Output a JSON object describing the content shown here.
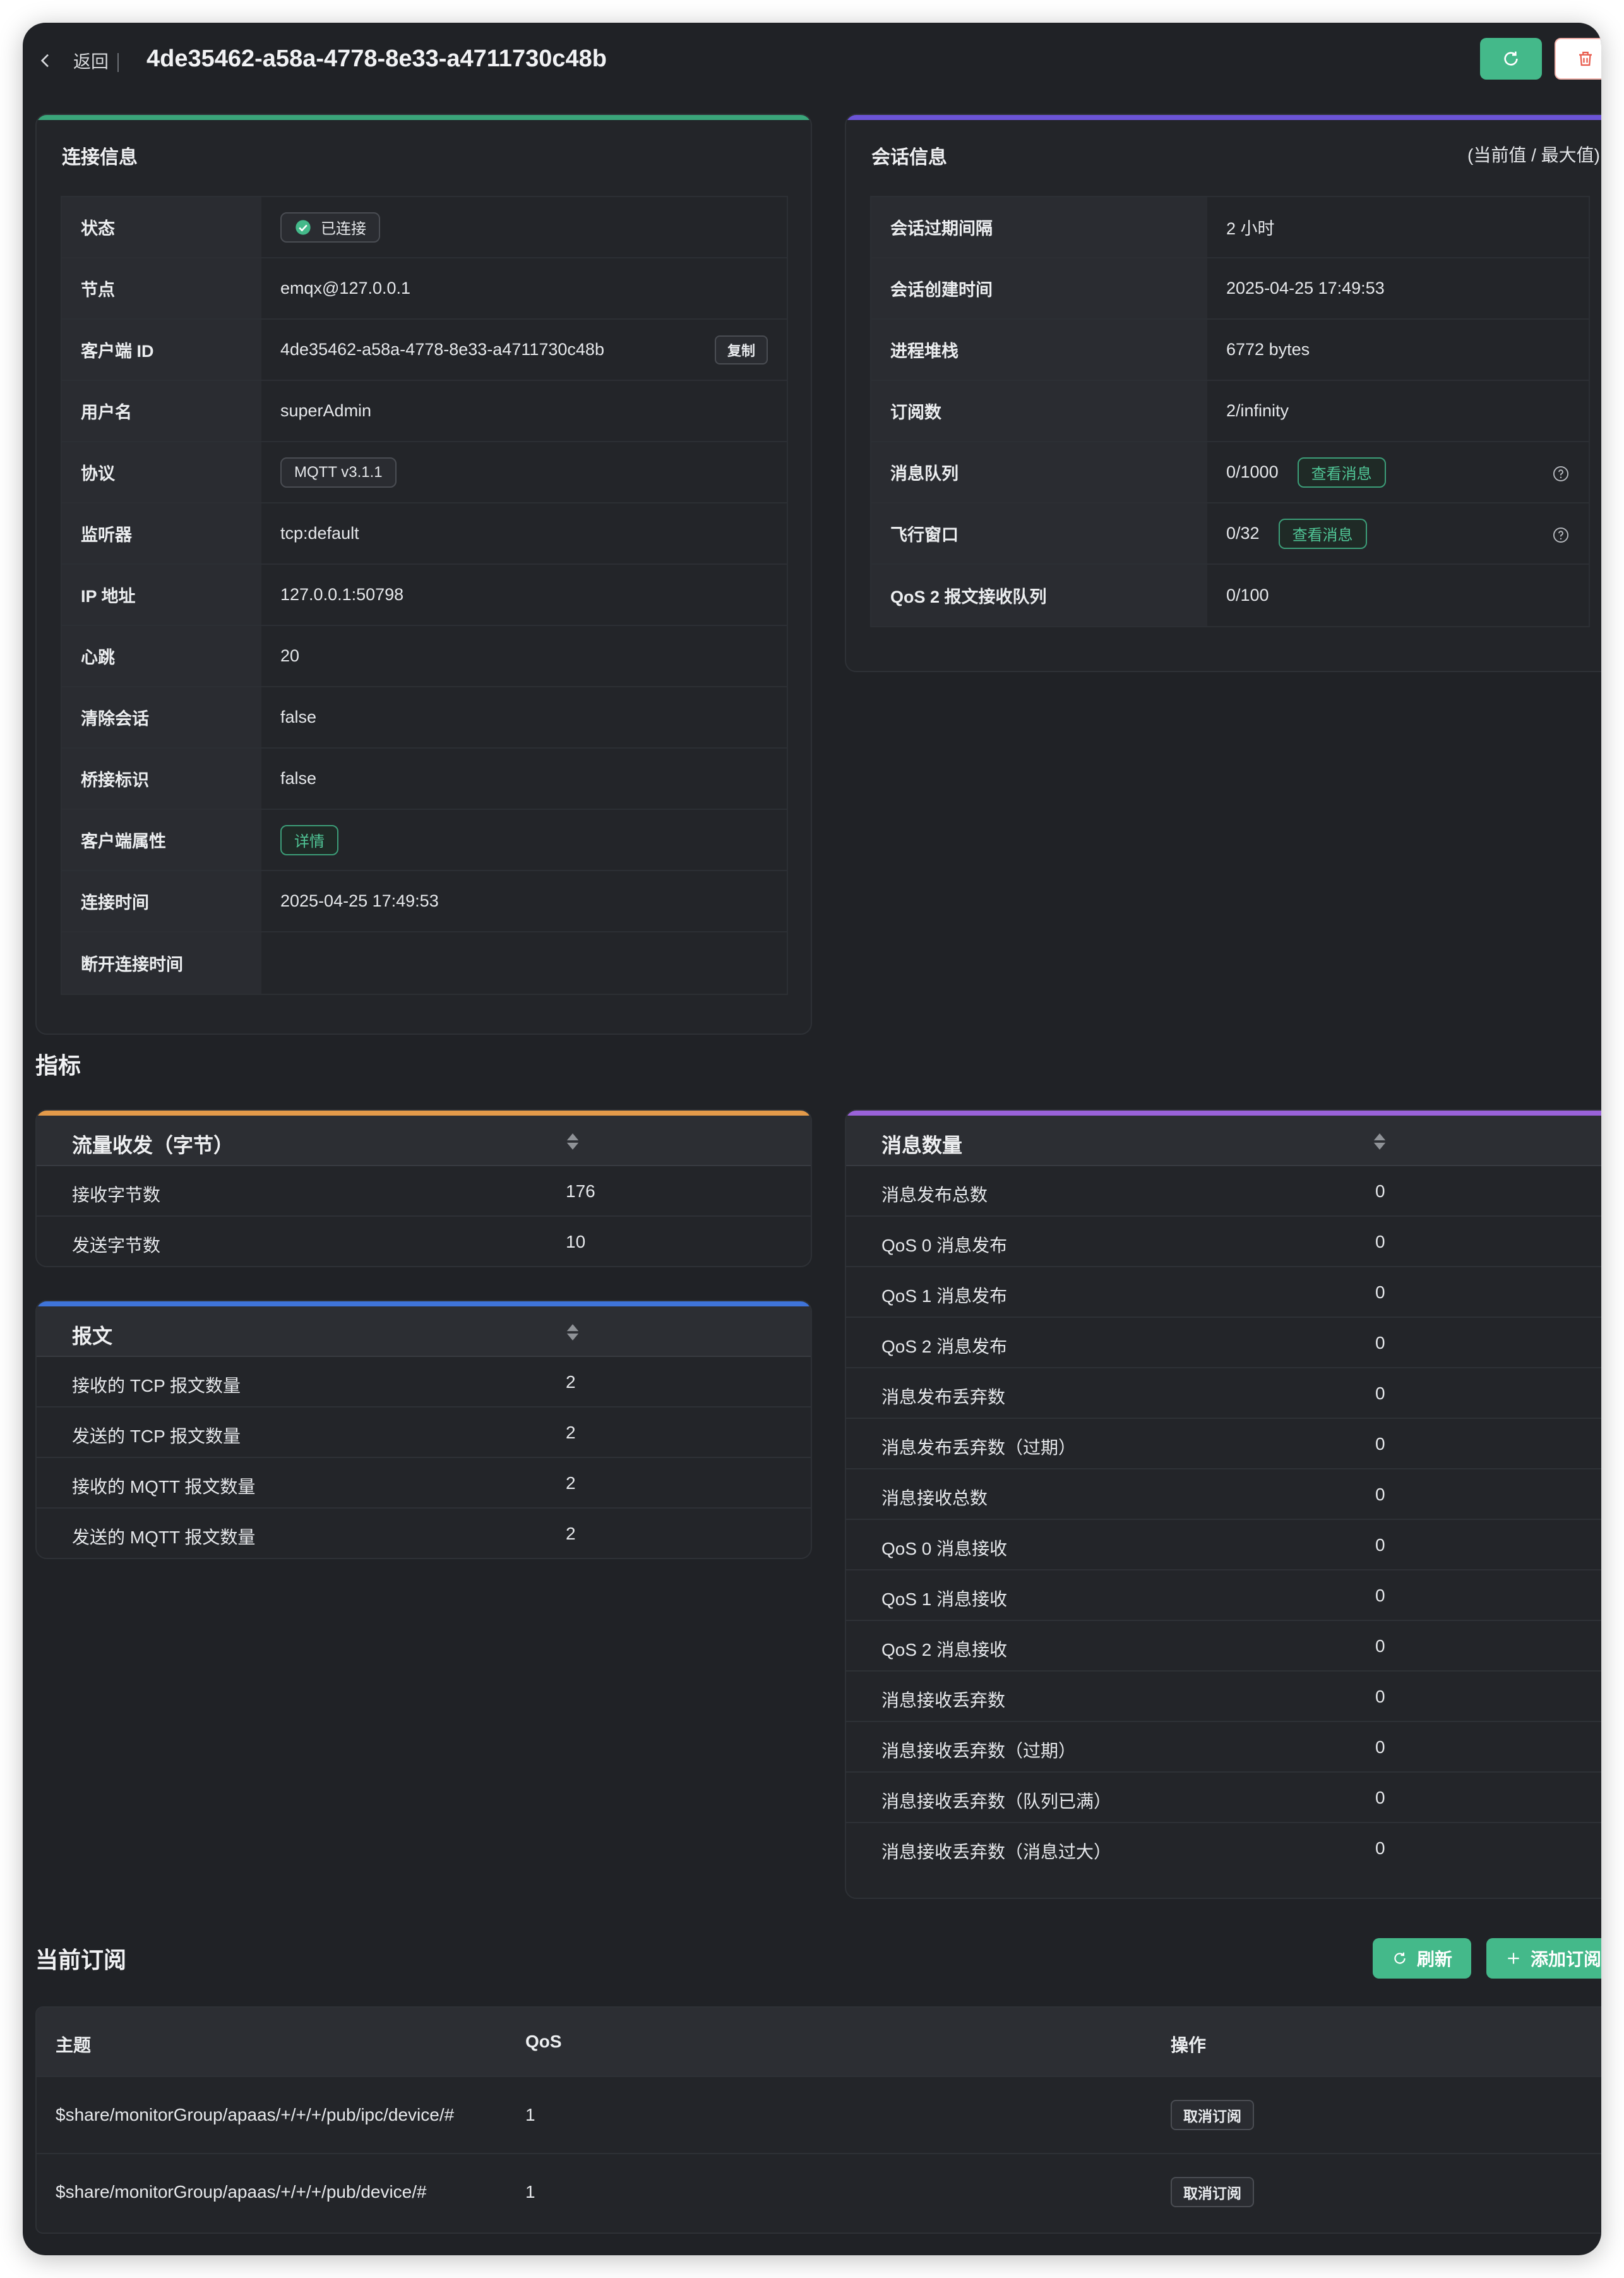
{
  "header": {
    "back_label": "返回",
    "title": "4de35462-a58a-4778-8e33-a4711730c48b"
  },
  "connection": {
    "title": "连接信息",
    "rows": [
      {
        "key": "状态",
        "value": "已连接"
      },
      {
        "key": "节点",
        "value": "emqx@127.0.0.1"
      },
      {
        "key": "客户端 ID",
        "value": "4de35462-a58a-4778-8e33-a4711730c48b"
      },
      {
        "key": "用户名",
        "value": "superAdmin"
      },
      {
        "key": "协议",
        "value": "MQTT v3.1.1"
      },
      {
        "key": "监听器",
        "value": "tcp:default"
      },
      {
        "key": "IP 地址",
        "value": "127.0.0.1:50798"
      },
      {
        "key": "心跳",
        "value": "20"
      },
      {
        "key": "清除会话",
        "value": "false"
      },
      {
        "key": "桥接标识",
        "value": "false"
      },
      {
        "key": "客户端属性",
        "value": "详情"
      },
      {
        "key": "连接时间",
        "value": "2025-04-25 17:49:53"
      },
      {
        "key": "断开连接时间",
        "value": ""
      }
    ],
    "copy_label": "复制"
  },
  "session": {
    "title": "会话信息",
    "note": "(当前值 / 最大值)",
    "view_messages_label": "查看消息",
    "rows": [
      {
        "key": "会话过期间隔",
        "value": "2 小时"
      },
      {
        "key": "会话创建时间",
        "value": "2025-04-25 17:49:53"
      },
      {
        "key": "进程堆栈",
        "value": "6772 bytes"
      },
      {
        "key": "订阅数",
        "value": "2/infinity"
      },
      {
        "key": "消息队列",
        "value": "0/1000"
      },
      {
        "key": "飞行窗口",
        "value": "0/32"
      },
      {
        "key": "QoS 2 报文接收队列",
        "value": "0/100"
      }
    ]
  },
  "metrics": {
    "title": "指标",
    "traffic": {
      "title": "流量收发（字节）",
      "rows": [
        {
          "name": "接收字节数",
          "value": "176"
        },
        {
          "name": "发送字节数",
          "value": "10"
        }
      ]
    },
    "packets": {
      "title": "报文",
      "rows": [
        {
          "name": "接收的 TCP 报文数量",
          "value": "2"
        },
        {
          "name": "发送的 TCP 报文数量",
          "value": "2"
        },
        {
          "name": "接收的 MQTT 报文数量",
          "value": "2"
        },
        {
          "name": "发送的 MQTT 报文数量",
          "value": "2"
        }
      ]
    },
    "messages": {
      "title": "消息数量",
      "rows": [
        {
          "name": "消息发布总数",
          "value": "0"
        },
        {
          "name": "QoS 0 消息发布",
          "value": "0"
        },
        {
          "name": "QoS 1 消息发布",
          "value": "0"
        },
        {
          "name": "QoS 2 消息发布",
          "value": "0"
        },
        {
          "name": "消息发布丢弃数",
          "value": "0"
        },
        {
          "name": "消息发布丢弃数（过期）",
          "value": "0"
        },
        {
          "name": "消息接收总数",
          "value": "0"
        },
        {
          "name": "QoS 0 消息接收",
          "value": "0"
        },
        {
          "name": "QoS 1 消息接收",
          "value": "0"
        },
        {
          "name": "QoS 2 消息接收",
          "value": "0"
        },
        {
          "name": "消息接收丢弃数",
          "value": "0"
        },
        {
          "name": "消息接收丢弃数（过期）",
          "value": "0"
        },
        {
          "name": "消息接收丢弃数（队列已满）",
          "value": "0"
        },
        {
          "name": "消息接收丢弃数（消息过大）",
          "value": "0"
        }
      ]
    }
  },
  "subscriptions": {
    "title": "当前订阅",
    "refresh_label": "刷新",
    "add_label": "添加订阅",
    "columns": [
      "主题",
      "QoS",
      "操作"
    ],
    "rows": [
      {
        "topic": "$share/monitorGroup/apaas/+/+/+/pub/ipc/device/#",
        "qos": "1",
        "action": "取消订阅"
      },
      {
        "topic": "$share/monitorGroup/apaas/+/+/+/pub/device/#",
        "qos": "1",
        "action": "取消订阅"
      }
    ]
  },
  "colors": {
    "accent_green": "#44b98a",
    "connection_bar": "#3aa57a",
    "session_bar": "#6b54d6",
    "traffic_bar": "#e39a4a",
    "packets_bar": "#3f74d9",
    "messages_bar": "#9a62d9"
  }
}
